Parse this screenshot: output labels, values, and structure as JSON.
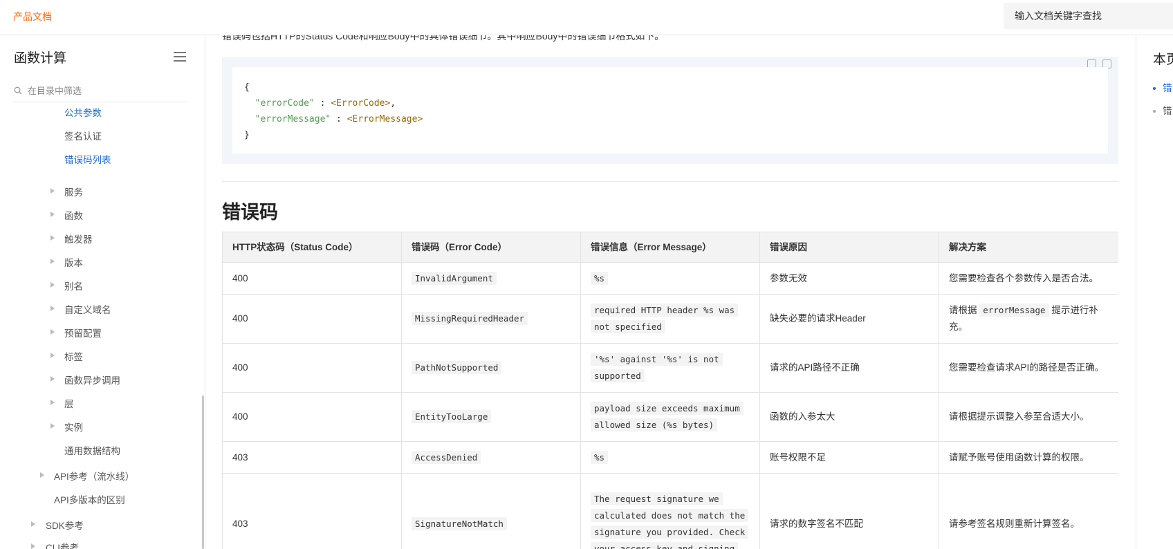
{
  "header": {
    "brand": "产品文档",
    "search_placeholder": "输入文档关键字查找"
  },
  "sidebar": {
    "title": "函数计算",
    "filter_placeholder": "在目录中筛选",
    "items": [
      {
        "label": "公共参数",
        "active": true,
        "expandable": false
      },
      {
        "label": "签名认证",
        "active": false,
        "expandable": false
      },
      {
        "label": "错误码列表",
        "active": true,
        "expandable": false
      },
      {
        "label": "服务",
        "active": false,
        "expandable": true
      },
      {
        "label": "函数",
        "active": false,
        "expandable": true
      },
      {
        "label": "触发器",
        "active": false,
        "expandable": true
      },
      {
        "label": "版本",
        "active": false,
        "expandable": true
      },
      {
        "label": "别名",
        "active": false,
        "expandable": true
      },
      {
        "label": "自定义域名",
        "active": false,
        "expandable": true
      },
      {
        "label": "预留配置",
        "active": false,
        "expandable": true
      },
      {
        "label": "标签",
        "active": false,
        "expandable": true
      },
      {
        "label": "函数异步调用",
        "active": false,
        "expandable": true
      },
      {
        "label": "层",
        "active": false,
        "expandable": true
      },
      {
        "label": "实例",
        "active": false,
        "expandable": true
      },
      {
        "label": "通用数据结构",
        "active": false,
        "expandable": false
      },
      {
        "label": "API参考（流水线）",
        "active": false,
        "expandable": true
      },
      {
        "label": "API多版本的区别",
        "active": false,
        "expandable": false
      },
      {
        "label": "SDK参考",
        "active": false,
        "expandable": true
      },
      {
        "label": "CLI参考",
        "active": false,
        "expandable": true
      }
    ]
  },
  "main": {
    "intro": "错误码包括HTTP的Status Code和响应Body中的具体错误细节。其中响应Body中的错误细节格式如下。",
    "code": {
      "open": "{",
      "line1_key": "\"errorCode\"",
      "line1_sep": " : ",
      "line1_val": "<ErrorCode>",
      "line1_end": ",",
      "line2_key": "\"errorMessage\"",
      "line2_sep": " : ",
      "line2_val": "<ErrorMessage>",
      "close": "}"
    },
    "section_title": "错误码",
    "table": {
      "headers": [
        "HTTP状态码（Status Code）",
        "错误码（Error Code）",
        "错误信息（Error Message）",
        "错误原因",
        "解决方案"
      ],
      "rows": [
        {
          "status": "400",
          "code": "InvalidArgument",
          "message": "%s",
          "reason": "参数无效",
          "solution": "您需要检查各个参数传入是否合法。"
        },
        {
          "status": "400",
          "code": "MissingRequiredHeader",
          "message": "required HTTP header %s was not specified",
          "reason": "缺失必要的请求Header",
          "solution_pre": "请根据 ",
          "solution_code": "errorMessage",
          "solution_post": " 提示进行补充。"
        },
        {
          "status": "400",
          "code": "PathNotSupported",
          "message": "'%s' against '%s' is not supported",
          "reason": "请求的API路径不正确",
          "solution": "您需要检查请求API的路径是否正确。"
        },
        {
          "status": "400",
          "code": "EntityTooLarge",
          "message": "payload size exceeds maximum allowed size (%s bytes)",
          "reason": "函数的入参太大",
          "solution": "请根据提示调整入参至合适大小。"
        },
        {
          "status": "403",
          "code": "AccessDenied",
          "message": "%s",
          "reason": "账号权限不足",
          "solution": "请赋予账号使用函数计算的权限。"
        },
        {
          "status": "403",
          "code": "SignatureNotMatch",
          "message": "The request signature we calculated does not match the signature you provided. Check your access key and signing",
          "reason": "请求的数字签名不匹配",
          "solution": "请参考签名规则重新计算签名。"
        }
      ]
    }
  },
  "toc": {
    "title": "本页",
    "items": [
      {
        "label": "错",
        "active": true
      },
      {
        "label": "错",
        "active": false
      }
    ]
  },
  "colors": {
    "brand": "#ff6a00",
    "link_active": "#1b6bd6",
    "code_key": "#50a14f",
    "code_value": "#986801"
  }
}
